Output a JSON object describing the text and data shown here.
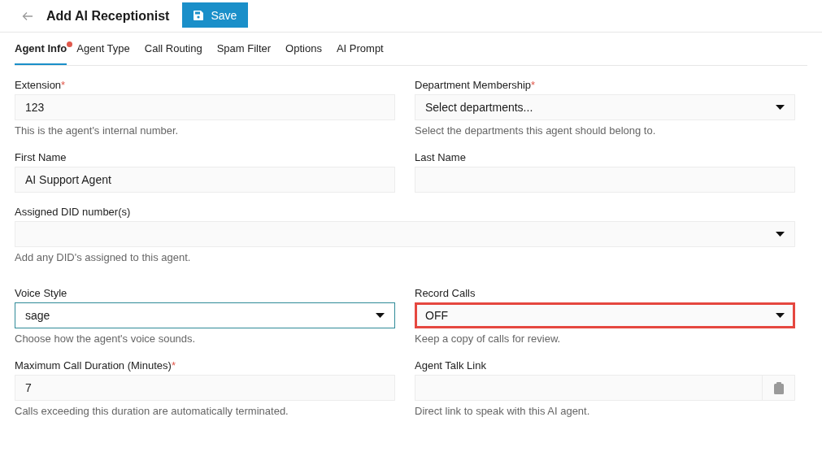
{
  "header": {
    "title": "Add AI Receptionist",
    "save_label": "Save"
  },
  "tabs": [
    {
      "label": "Agent Info",
      "selected": true,
      "alert": true
    },
    {
      "label": "Agent Type",
      "selected": false,
      "alert": false
    },
    {
      "label": "Call Routing",
      "selected": false,
      "alert": false
    },
    {
      "label": "Spam Filter",
      "selected": false,
      "alert": false
    },
    {
      "label": "Options",
      "selected": false,
      "alert": false
    },
    {
      "label": "AI Prompt",
      "selected": false,
      "alert": false
    }
  ],
  "rows": [
    {
      "fields": [
        {
          "kind": "text",
          "label": "Extension",
          "required_mark": "*",
          "value": "123",
          "hint": "This is the agent's internal number.",
          "focused": false,
          "highlighted": false
        },
        {
          "kind": "select",
          "label": "Department Membership",
          "required_mark": "*",
          "placeholder": "Select departments...",
          "hint": "Select the departments this agent should belong to.",
          "focused": false,
          "highlighted": false
        }
      ]
    },
    {
      "fields": [
        {
          "kind": "text",
          "label": "First Name",
          "value": "AI Support Agent",
          "focused": false,
          "highlighted": false
        },
        {
          "kind": "text",
          "label": "Last Name",
          "focused": false,
          "highlighted": false
        }
      ]
    },
    {
      "fields": [
        {
          "kind": "select",
          "label": "Assigned DID number(s)",
          "hint": "Add any DID's assigned to this agent.",
          "focused": false,
          "highlighted": false,
          "wide": true
        }
      ]
    },
    {
      "fields": [
        {
          "kind": "select",
          "label": "Voice Style",
          "value": "sage",
          "hint": "Choose how the agent's voice sounds.",
          "focused": true,
          "highlighted": false
        },
        {
          "kind": "select",
          "label": "Record Calls",
          "value": "OFF",
          "hint": "Keep a copy of calls for review.",
          "focused": false,
          "highlighted": true
        }
      ]
    },
    {
      "fields": [
        {
          "kind": "text",
          "label": "Maximum Call Duration (Minutes)",
          "required_mark": "*",
          "value": "7",
          "hint": "Calls exceeding this duration are automatically terminated.",
          "focused": false,
          "highlighted": false
        },
        {
          "kind": "copy",
          "label": "Agent Talk Link",
          "hint": "Direct link to speak with this AI agent.",
          "focused": false,
          "highlighted": false
        }
      ]
    }
  ]
}
